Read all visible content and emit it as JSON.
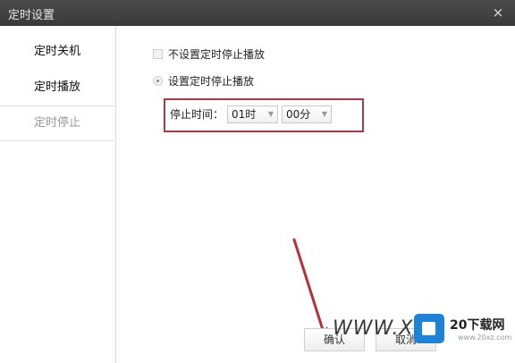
{
  "window": {
    "title": "定时设置",
    "close_glyph": "×"
  },
  "sidebar": {
    "items": [
      {
        "label": "定时关机"
      },
      {
        "label": "定时播放"
      },
      {
        "label": "定时停止"
      }
    ]
  },
  "options": {
    "no_timer_label": "不设置定时停止播放",
    "timer_label": "设置定时停止播放"
  },
  "stop_time": {
    "label": "停止时间：",
    "hour": "01时",
    "minute": "00分"
  },
  "buttons": {
    "confirm": "确认",
    "cancel": "取消"
  },
  "watermark": {
    "text": "WWW.XFD",
    "logo_text": "20下载网",
    "logo_url": "www.20xz.com"
  },
  "colors": {
    "titlebar": "#3f3f3f",
    "highlight_border": "#a63a49",
    "arrow": "#b8303e",
    "logo_blue": "#1e82d6"
  }
}
